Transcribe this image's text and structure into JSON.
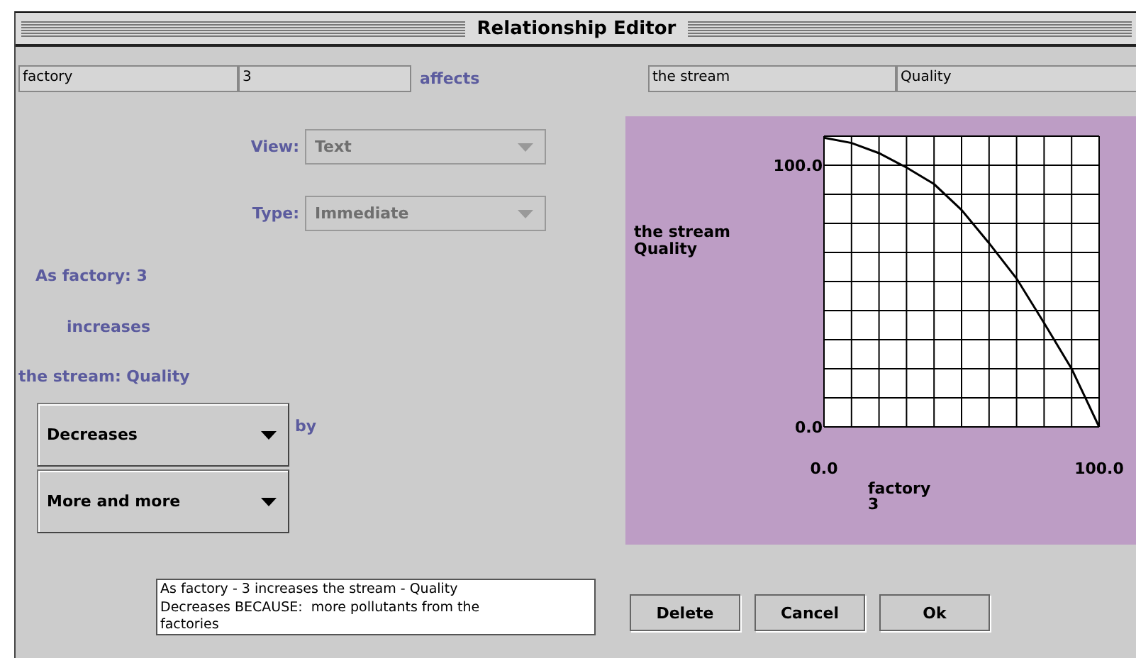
{
  "window": {
    "title": "Relationship Editor"
  },
  "header": {
    "cause_object": "factory",
    "cause_attribute": "3",
    "verb": "affects",
    "effect_object": "the stream",
    "effect_attribute": "Quality"
  },
  "selects": [
    {
      "label": "View:",
      "value": "Text",
      "disabled": true
    },
    {
      "label": "Type:",
      "value": "Immediate",
      "disabled": true
    }
  ],
  "statement": {
    "line_1": "As factory: 3",
    "line_2": "increases",
    "line_3": "the stream: Quality"
  },
  "direction": {
    "value": "Decreases",
    "suffix": "by"
  },
  "rate": {
    "value": "More and more"
  },
  "explanation": "As factory - 3 increases the stream - Quality\nDecreases BECAUSE:  more pollutants from the\nfactories",
  "buttons": [
    "Delete",
    "Cancel",
    "Ok"
  ],
  "chart": {
    "chart_data": {
      "type": "line",
      "xlabel": "factory\n3",
      "ylabel": "the stream\nQuality",
      "x": [
        0,
        10,
        20,
        30,
        40,
        50,
        60,
        70,
        80,
        90,
        100
      ],
      "series": [
        {
          "color": "#000000",
          "values": [
            110.5,
            108.5,
            104.6,
            99.1,
            92.8,
            82.9,
            70.2,
            56.7,
            39.7,
            22.2,
            0
          ]
        }
      ],
      "xlim": [
        0,
        100
      ],
      "ylim": [
        0,
        111.1
      ],
      "xticks": [
        {
          "value": 0,
          "label": "0.0"
        },
        {
          "value": 100,
          "label": "100.0"
        }
      ],
      "yticks": [
        {
          "value": 0,
          "label": "0.0"
        },
        {
          "value": 100,
          "label": "100.0"
        }
      ]
    }
  }
}
